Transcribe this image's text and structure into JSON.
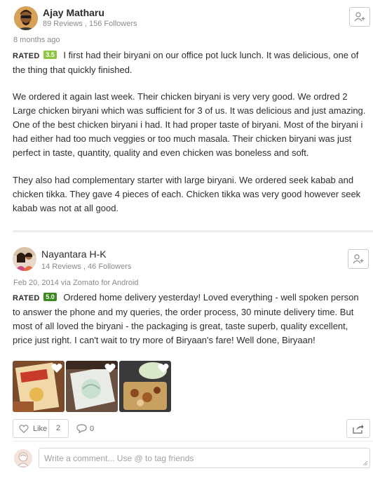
{
  "reviews": [
    {
      "author": "Ajay Matharu",
      "stats": "89 Reviews , 156 Followers",
      "time": "8 months ago",
      "rated_label": "RATED",
      "rating": "3.5",
      "rating_color": "#8cc63e",
      "paragraphs": [
        "I first had their biryani on our office pot luck lunch. It was delicious, one of the thing that quickly finished.",
        "We ordered it again last week. Their chicken biryani is very very good. We ordred 2 Large chicken biryani which was sufficient for 3 of us. It was delicious and just amazing. One of the best chicken biryani i had. It had proper taste of biryani. Most of the biryani i had either had too much veggies or too much masala. Their chicken biryani was just perfect in taste, quantity, quality and even chicken was boneless and soft.",
        "They also had complementary starter with large biryani. We ordered seek kabab and chicken tikka. They gave 4 pieces of each. Chicken tikka was very good however seek kabab was not at all good."
      ]
    },
    {
      "author": "Nayantara H-K",
      "stats": "14 Reviews , 46 Followers",
      "time": "Feb 20, 2014 via Zomato for Android",
      "rated_label": "RATED",
      "rating": "5.0",
      "rating_color": "#3a8a1f",
      "paragraphs": [
        "Ordered home delivery yesterday! Loved everything - well spoken person to answer the phone and my queries, the order process, 30 minute delivery time. But most of all loved the biryani - the packaging is great, taste superb, quality excellent, price just right. I can't wait to try more of Biryaan's fare! Well done, Biryaan!"
      ],
      "photos": [
        "photo-1",
        "photo-2",
        "photo-3"
      ],
      "like_label": "Like",
      "like_count": "2",
      "comment_count": "0"
    }
  ],
  "comment_input": {
    "placeholder": "Write a comment... Use @ to tag friends"
  }
}
